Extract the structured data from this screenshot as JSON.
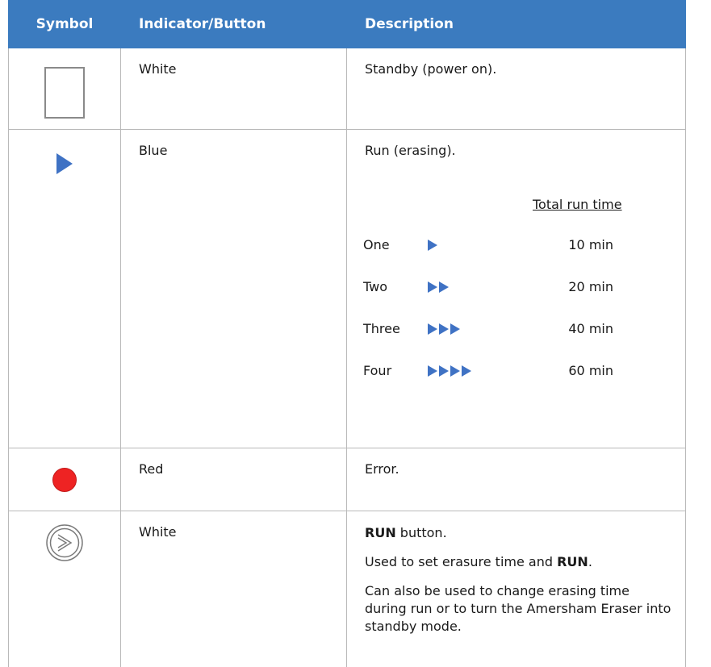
{
  "header": {
    "col_symbol": "Symbol",
    "col_indicator": "Indicator/Button",
    "col_description": "Description"
  },
  "rows": [
    {
      "indicator": "White",
      "description": "Standby (power on).",
      "symbol_icon": "square-outline-icon"
    },
    {
      "indicator": "Blue",
      "description": "Run (erasing).",
      "symbol_icon": "play-triangle-icon"
    },
    {
      "indicator": "Red",
      "description": "Error.",
      "symbol_icon": "red-dot-icon"
    },
    {
      "indicator": "White",
      "symbol_icon": "run-button-icon"
    }
  ],
  "run_times": {
    "header": "Total run time",
    "items": [
      {
        "label": "One",
        "count": 1,
        "time": "10 min"
      },
      {
        "label": "Two",
        "count": 2,
        "time": "20 min"
      },
      {
        "label": "Three",
        "count": 3,
        "time": "40 min"
      },
      {
        "label": "Four",
        "count": 4,
        "time": "60 min"
      }
    ]
  },
  "run_button": {
    "line1_bold": "RUN",
    "line1_rest": " button.",
    "line2_pre": "Used to set erasure time and ",
    "line2_bold": "RUN",
    "line2_post": ".",
    "line3": "Can also be used to change erasing time during run or to turn the Amersham Eraser into standby mode."
  },
  "colors": {
    "header_bg": "#3b7bbf",
    "blue_indicator": "#3f72c4",
    "red_indicator": "#ee2323",
    "border": "#b9b9b9"
  }
}
